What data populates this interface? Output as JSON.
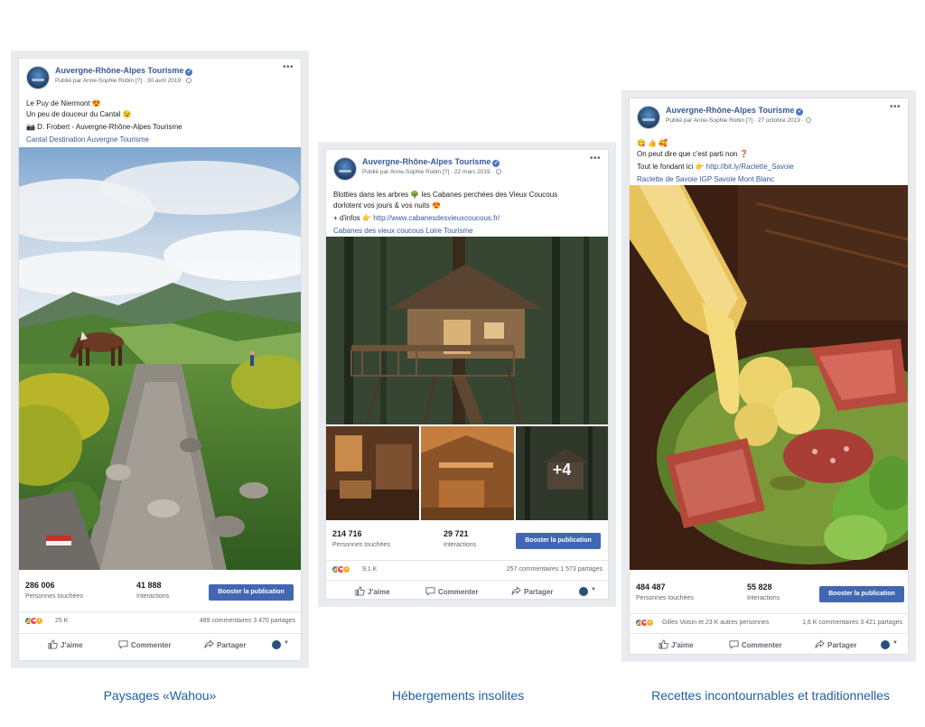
{
  "posts": [
    {
      "page_name": "Auvergne-Rhône-Alpes Tourisme",
      "meta": "Publié par Anne-Sophie Robin [?] · 30 avril 2019 ·",
      "lines": [
        "Le Puy de Niermont 😍",
        "Un peu de douceur du Cantal 😉",
        "📷 D. Frobert - Auvergne-Rhône-Alpes Tourisme"
      ],
      "tags": "Cantal Destination Auvergne Tourisme",
      "reach_value": "286 006",
      "reach_label": "Personnes touchées",
      "interactions_value": "41 888",
      "interactions_label": "Interactions",
      "boost_label": "Booster la publication",
      "reactions_count": "25 K",
      "comments_shares": "489 commentaires  3 470 partages",
      "like_label": "J'aime",
      "comment_label": "Commenter",
      "share_label": "Partager"
    },
    {
      "page_name": "Auvergne-Rhône-Alpes Tourisme",
      "meta": "Publié par Anne-Sophie Robin [?] · 22 mars 2019 ·",
      "lines": [
        "Blotties dans les arbres 🌳 les Cabanes perchées des Vieux Coucous",
        "dorlotent vos jours & vos nuits 😍"
      ],
      "info_prefix": "+ d'infos 👉 ",
      "info_link": "http://www.cabanesdesvieuxcoucous.fr/",
      "tags": "Cabanes des vieux coucous Loire Tourisme",
      "more_photos": "+4",
      "reach_value": "214 716",
      "reach_label": "Personnes touchées",
      "interactions_value": "29 721",
      "interactions_label": "Interactions",
      "boost_label": "Booster la publication",
      "reactions_count": "9,1 K",
      "comments_shares": "257 commentaires  1 573 partages",
      "like_label": "J'aime",
      "comment_label": "Commenter",
      "share_label": "Partager"
    },
    {
      "page_name": "Auvergne-Rhône-Alpes Tourisme",
      "meta": "Publié par Anne-Sophie Robin [?] · 27 octobre 2019 ·",
      "lines": [
        "😋 👍 🥰",
        "On peut dire que c'est parti non ❓"
      ],
      "info_prefix": "Tout le fondant ici 👉 ",
      "info_link": "http://bit.ly/Raclette_Savoie",
      "tags": "Raclette de Savoie IGP Savoie Mont Blanc",
      "reach_value": "484 487",
      "reach_label": "Personnes touchées",
      "interactions_value": "55 828",
      "interactions_label": "Interactions",
      "boost_label": "Booster la publication",
      "reactions_count": "Gilles Voisin et 23 K autres personnes",
      "comments_shares": "1,6 K commentaires  3 421 partages",
      "like_label": "J'aime",
      "comment_label": "Commenter",
      "share_label": "Partager"
    }
  ],
  "captions": [
    "Paysages «Wahou»",
    "Hébergements insolites",
    "Recettes incontournables et traditionnelles"
  ],
  "colors": {
    "link": "#385898",
    "boost": "#4267b2",
    "caption": "#1f5fa8",
    "frame": "#e9ebee"
  }
}
